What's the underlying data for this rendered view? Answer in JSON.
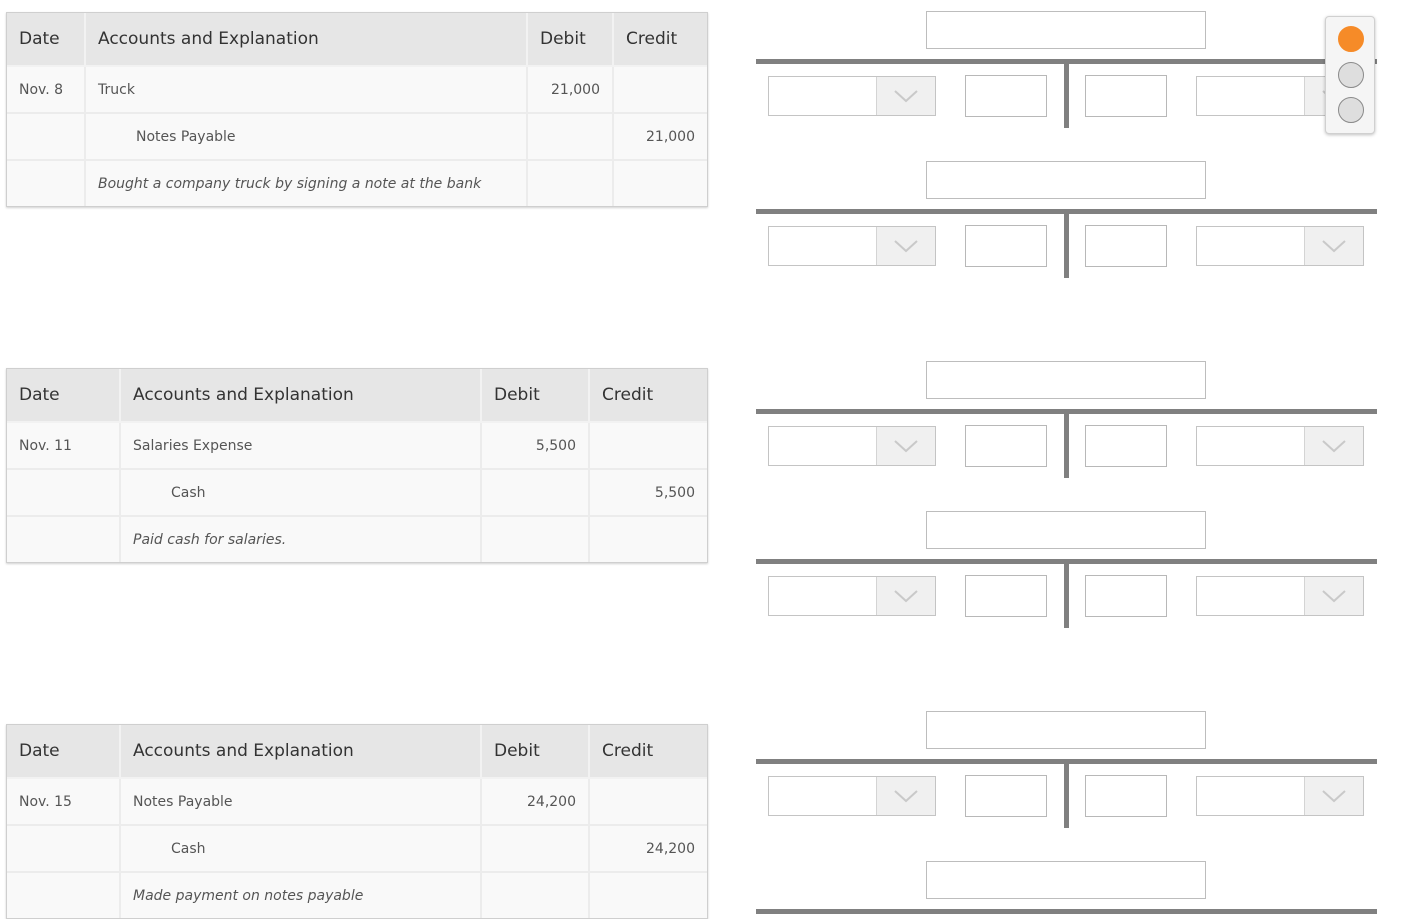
{
  "headers": {
    "date": "Date",
    "accounts": "Accounts and Explanation",
    "debit": "Debit",
    "credit": "Credit"
  },
  "journals": [
    {
      "date": "Nov. 8",
      "debit_account": "Truck",
      "debit_amount": "21,000",
      "credit_account": "Notes Payable",
      "credit_amount": "21,000",
      "explanation": "Bought a company truck by signing a note at the bank"
    },
    {
      "date": "Nov. 11",
      "debit_account": "Salaries Expense",
      "debit_amount": "5,500",
      "credit_account": "Cash",
      "credit_amount": "5,500",
      "explanation": "Paid cash for salaries."
    },
    {
      "date": "Nov. 15",
      "debit_account": "Notes Payable",
      "debit_amount": "24,200",
      "credit_account": "Cash",
      "credit_amount": "24,200",
      "explanation": "Made payment on notes payable"
    }
  ],
  "t_accounts": {
    "count": 6,
    "title_value": "",
    "debit_account_selected": "",
    "debit_amount": "",
    "credit_amount": "",
    "credit_account_selected": ""
  },
  "stepper": {
    "steps": 3,
    "active_step": 1,
    "active_color": "#f68b28"
  },
  "icons": {
    "dropdown": "chevron-down-icon"
  }
}
